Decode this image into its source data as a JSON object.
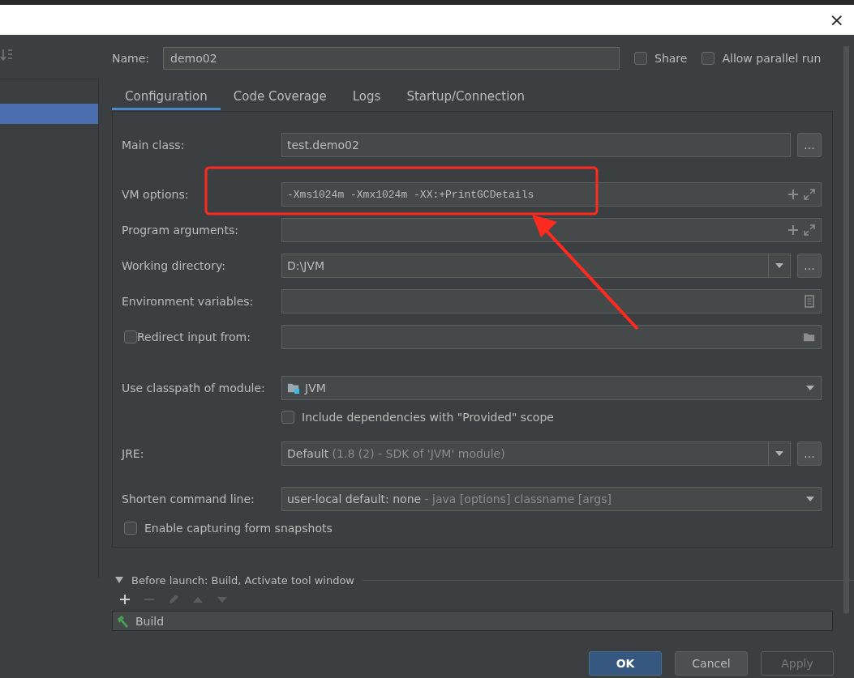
{
  "window": {
    "close": "×"
  },
  "name_field": {
    "label": "Name:",
    "value": "demo02"
  },
  "options": [
    {
      "label": "Share",
      "checked": false
    },
    {
      "label": "Allow parallel run",
      "checked": false
    }
  ],
  "tabs": [
    {
      "label": "Configuration",
      "selected": true
    },
    {
      "label": "Code Coverage",
      "selected": false
    },
    {
      "label": "Logs",
      "selected": false
    },
    {
      "label": "Startup/Connection",
      "selected": false
    }
  ],
  "rows": [
    {
      "kind": "text",
      "label": "Main class:",
      "value": "test.demo02",
      "browse": "..."
    },
    {
      "kind": "expandable",
      "label": "VM options:",
      "value": "-Xms1024m -Xmx1024m -XX:+PrintGCDetails",
      "mono": true
    },
    {
      "kind": "expandable",
      "label": "Program arguments:"
    },
    {
      "kind": "combo",
      "label": "Working directory:",
      "value": "D:\\JVM",
      "browse": "..."
    },
    {
      "kind": "document",
      "label": "Environment variables:"
    },
    {
      "kind": "checkfield",
      "label": "Redirect input from:",
      "checked": false
    },
    {
      "kind": "module",
      "label": "Use classpath of module:",
      "value": "JVM"
    },
    {
      "kind": "checkbox",
      "label": "Include dependencies with \"Provided\" scope",
      "checked": false
    },
    {
      "kind": "combo",
      "label": "JRE:",
      "value": "Default",
      "hint": " (1.8 (2) - SDK of 'JVM' module)",
      "browse": "..."
    },
    {
      "kind": "select",
      "label": "Shorten command line:",
      "value": "user-local default: none",
      "hint": " - java [options] classname [args]"
    },
    {
      "kind": "checkbox",
      "label": "Enable capturing form snapshots",
      "checked": false,
      "flush": true
    }
  ],
  "before_launch": {
    "title": "Before launch: Build, Activate tool window",
    "expanded": true,
    "tasks": [
      {
        "label": "Build"
      }
    ]
  },
  "buttons": [
    {
      "label": "OK",
      "kind": "default"
    },
    {
      "label": "Cancel",
      "kind": "normal"
    },
    {
      "label": "Apply",
      "kind": "disabled"
    }
  ]
}
